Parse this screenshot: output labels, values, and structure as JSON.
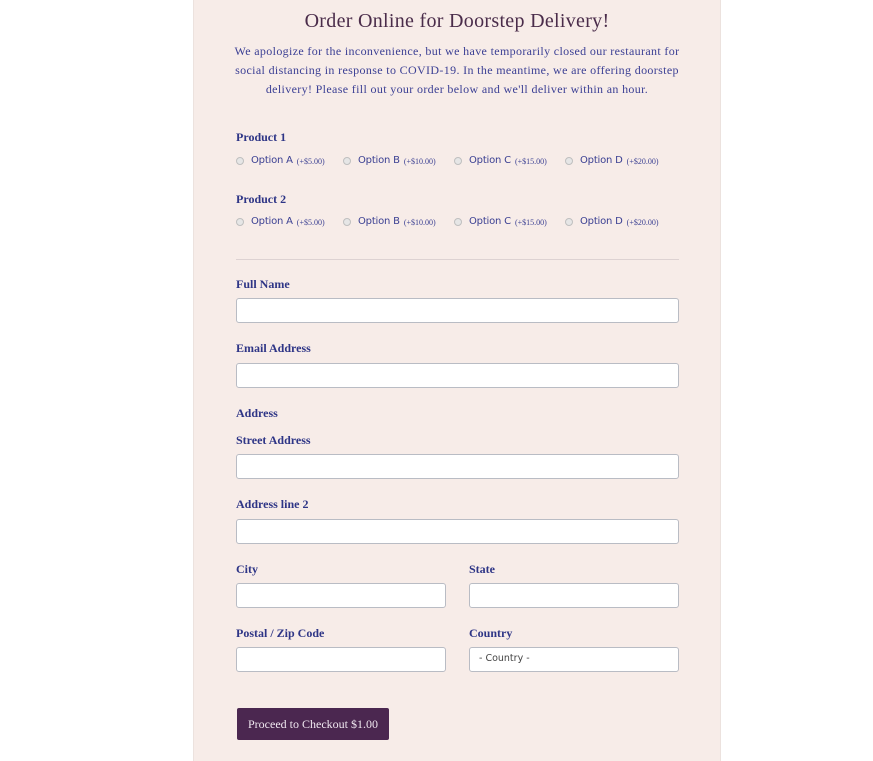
{
  "form": {
    "title": "Order Online for Doorstep Delivery!",
    "intro": "We apologize for the inconvenience, but we have temporarily closed our restaurant for social distancing in response to COVID-19. In the meantime, we are offering doorstep delivery! Please fill out your order below and we'll deliver within an hour.",
    "products": [
      {
        "label": "Product 1",
        "options": [
          {
            "name": "Option A",
            "price": "(+$5.00)"
          },
          {
            "name": "Option B",
            "price": "(+$10.00)"
          },
          {
            "name": "Option C",
            "price": "(+$15.00)"
          },
          {
            "name": "Option D",
            "price": "(+$20.00)"
          }
        ]
      },
      {
        "label": "Product 2",
        "options": [
          {
            "name": "Option A",
            "price": "(+$5.00)"
          },
          {
            "name": "Option B",
            "price": "(+$10.00)"
          },
          {
            "name": "Option C",
            "price": "(+$15.00)"
          },
          {
            "name": "Option D",
            "price": "(+$20.00)"
          }
        ]
      }
    ],
    "fields": {
      "full_name": {
        "label": "Full Name",
        "value": ""
      },
      "email": {
        "label": "Email Address",
        "value": ""
      },
      "address_heading": "Address",
      "street": {
        "label": "Street Address",
        "value": ""
      },
      "line2": {
        "label": "Address line 2",
        "value": ""
      },
      "city": {
        "label": "City",
        "value": ""
      },
      "state": {
        "label": "State",
        "value": ""
      },
      "zip": {
        "label": "Postal / Zip Code",
        "value": ""
      },
      "country": {
        "label": "Country",
        "selected": "- Country -"
      }
    },
    "submit_label": "Proceed to Checkout $1.00"
  },
  "colors": {
    "card_bg": "#f7ece8",
    "label": "#2e3586",
    "title": "#4a2c4a",
    "button_bg": "#4b2750"
  }
}
